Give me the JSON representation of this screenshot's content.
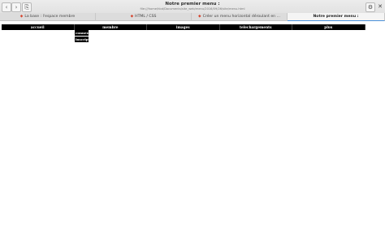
{
  "window": {
    "title": "Notre premier menu :",
    "url": "file:///home/hbd/Documents/site_web/menu/2016/09/26/site/menu.html",
    "nav_icons": {
      "back": "chevron-left-icon",
      "forward": "chevron-right-icon",
      "bookmarks": "bookmarks-icon"
    },
    "menu_icon": "gear-icon",
    "close_icon": "close-icon"
  },
  "tabs": [
    {
      "label": "La base : l'espace membre",
      "icon": "html5-icon",
      "active": false
    },
    {
      "label": "HTML / CSS",
      "icon": "html5-icon",
      "active": false
    },
    {
      "label": "Créer un menu horizontal déroulant en ...",
      "icon": "html5-icon",
      "active": false
    },
    {
      "label": "Notre premier menu :",
      "icon": "",
      "active": true
    }
  ],
  "menu": {
    "items": [
      "accueil",
      "membre",
      "images",
      "telechargements",
      "plus"
    ],
    "submenu": [
      "connexion",
      "inscription"
    ]
  }
}
